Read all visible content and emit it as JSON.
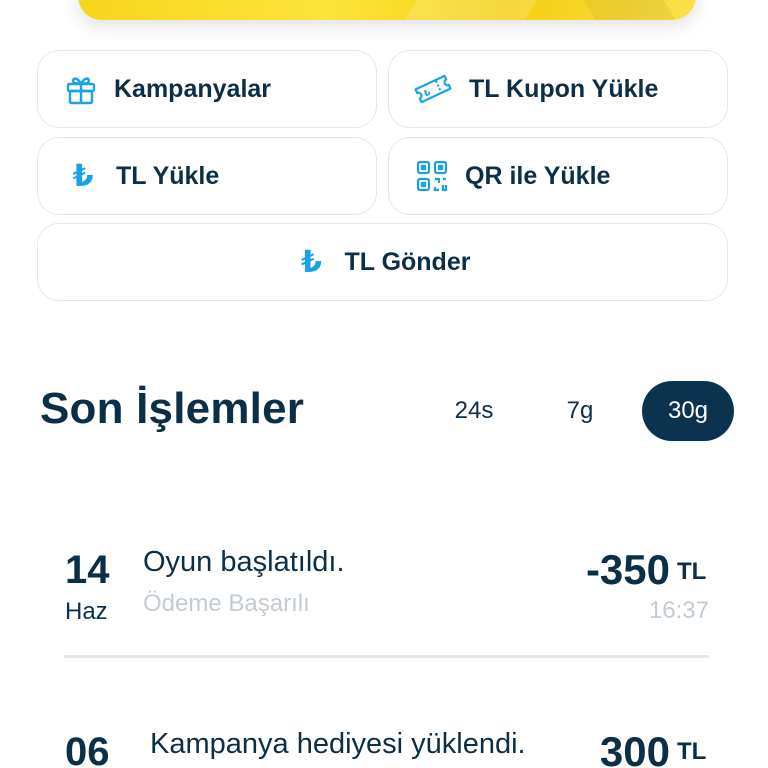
{
  "actions": {
    "campaigns_label": "Kampanyalar",
    "coupon_label": "TL Kupon Yükle",
    "load_tl_label": "TL Yükle",
    "qr_label": "QR ile Yükle",
    "send_tl_label": "TL Gönder",
    "lira_glyph": "₺"
  },
  "transactions": {
    "title": "Son İşlemler",
    "filters": [
      {
        "label": "24s",
        "selected": false
      },
      {
        "label": "7g",
        "selected": false
      },
      {
        "label": "30g",
        "selected": true
      }
    ],
    "items": [
      {
        "day": "14",
        "month": "Haz",
        "title": "Oyun başlatıldı.",
        "status": "Ödeme Başarılı",
        "amount": "-350",
        "currency": "TL",
        "time": "16:37"
      },
      {
        "day": "06",
        "month": "",
        "title": "Kampanya hediyesi yüklendi.",
        "status": "",
        "amount": "300",
        "currency": "TL",
        "time": ""
      }
    ]
  },
  "colors": {
    "accent": "#1aa2e8",
    "text": "#0b2f47",
    "selected_filter_bg": "#0b3350",
    "banner_yellow": "#f7d51d",
    "muted": "#c3cbd3"
  }
}
